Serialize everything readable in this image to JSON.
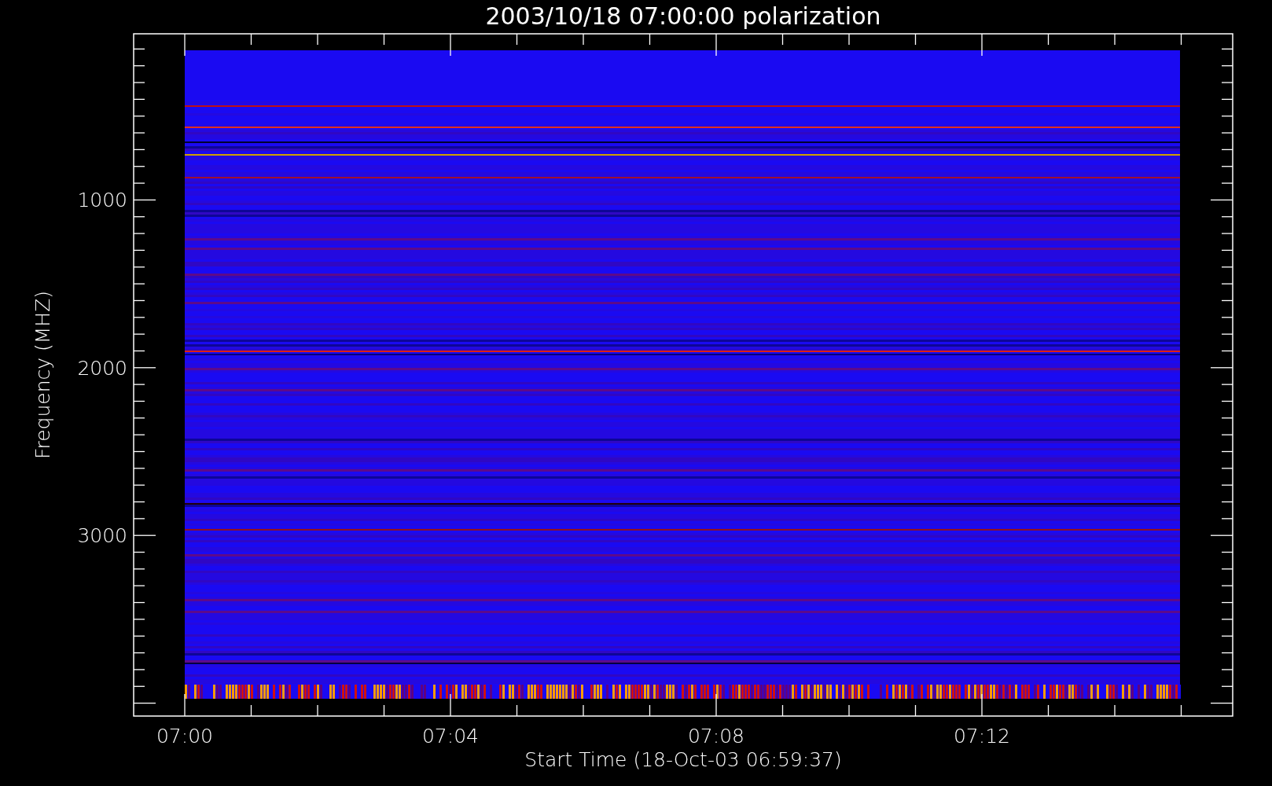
{
  "plot": {
    "title": "2003/10/18 07:00:00 polarization",
    "ylabel": "Frequency (MHZ)",
    "yticks": [
      "1000",
      "2000",
      "3000"
    ],
    "xticks": [
      "07:00",
      "07:04",
      "07:08",
      "07:12"
    ],
    "xlabel": "Start Time (18-Oct-03 06:59:37)"
  }
}
